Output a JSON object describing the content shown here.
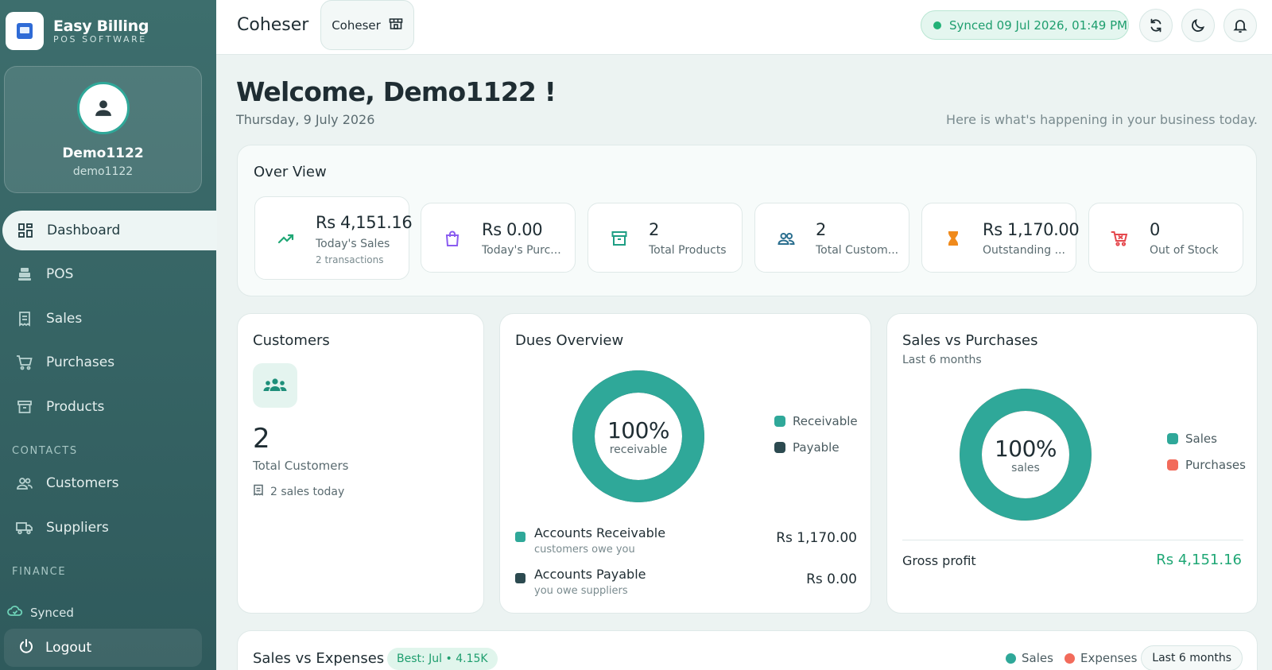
{
  "brand": {
    "name": "Easy Billing",
    "sub": "POS SOFTWARE"
  },
  "profile": {
    "name": "Demo1122",
    "username": "demo1122"
  },
  "nav": {
    "dashboard": "Dashboard",
    "pos": "POS",
    "sales": "Sales",
    "purchases": "Purchases",
    "products": "Products",
    "contacts_label": "CONTACTS",
    "customers": "Customers",
    "suppliers": "Suppliers",
    "finance_label": "FINANCE"
  },
  "sidebar_footer": {
    "sync_status": "Synced",
    "logout": "Logout"
  },
  "topbar": {
    "store_title": "Coheser",
    "store_chip": "Coheser",
    "sync_text": "Synced 09 Jul 2026, 01:49 PM"
  },
  "welcome": {
    "heading": "Welcome, Demo1122 !",
    "date": "Thursday, 9 July 2026",
    "tagline": "Here is what's happening in your business today."
  },
  "overview": {
    "title": "Over View",
    "stats": [
      {
        "value": "Rs 4,151.16",
        "label": "Today's Sales",
        "sub": "2 transactions",
        "icon": "trending-up-icon",
        "color": "#1fa775",
        "bg": "#e2f5ee"
      },
      {
        "value": "Rs 0.00",
        "label": "Today's Purc...",
        "icon": "shopping-bag-icon",
        "color": "#8a5cf0",
        "bg": "#efe8fd"
      },
      {
        "value": "2",
        "label": "Total Products",
        "icon": "archive-box-icon",
        "color": "#1e9e84",
        "bg": "#e2f4ef"
      },
      {
        "value": "2",
        "label": "Total Custom...",
        "icon": "users-icon",
        "color": "#2b6f8f",
        "bg": "#e1eff8"
      },
      {
        "value": "Rs 1,170.00",
        "label": "Outstanding ...",
        "icon": "hourglass-icon",
        "color": "#f08a1c",
        "bg": "#fdeedd"
      },
      {
        "value": "0",
        "label": "Out of Stock",
        "icon": "cart-icon",
        "color": "#e5484d",
        "bg": "#fde7e6"
      }
    ]
  },
  "customers_card": {
    "title": "Customers",
    "count": "2",
    "label": "Total Customers",
    "sales_today": "2 sales today"
  },
  "dues": {
    "title": "Dues Overview",
    "percent": "100%",
    "sub": "receivable",
    "legend": [
      "Receivable",
      "Payable"
    ],
    "receivable_share": 1.0,
    "colors": {
      "receivable": "#2fa899",
      "payable": "#2c4a50"
    },
    "accounts": [
      {
        "name": "Accounts Receivable",
        "sub": "customers owe you",
        "value": "Rs 1,170.00"
      },
      {
        "name": "Accounts Payable",
        "sub": "you owe suppliers",
        "value": "Rs 0.00"
      }
    ]
  },
  "sales_vs_purchases": {
    "title": "Sales vs Purchases",
    "subtitle": "Last 6 months",
    "percent": "100%",
    "sub": "sales",
    "legend": [
      "Sales",
      "Purchases"
    ],
    "sales_share": 1.0,
    "colors": {
      "sales": "#2fa899",
      "purchases": "#f26b5b"
    },
    "gross_profit_label": "Gross profit",
    "gross_profit_value": "Rs 4,151.16"
  },
  "sales_vs_expenses": {
    "title": "Sales vs Expenses",
    "best": "Best: Jul • 4.15K",
    "legend": [
      "Sales",
      "Expenses"
    ],
    "range": "Last 6 months"
  }
}
